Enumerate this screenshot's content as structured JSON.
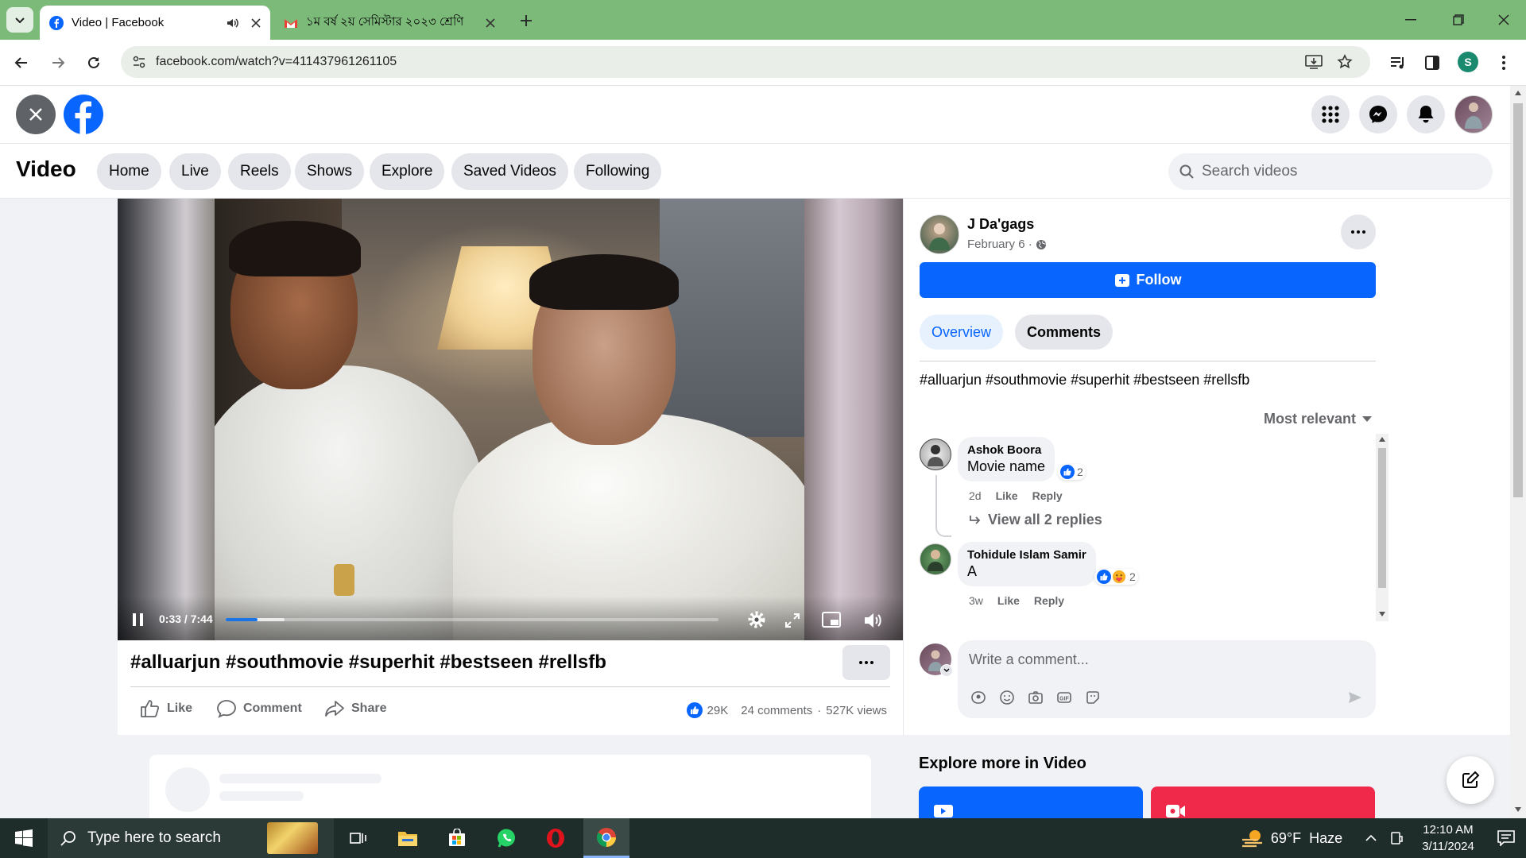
{
  "browser": {
    "tabs": [
      {
        "title": "Video | Facebook",
        "active": true
      },
      {
        "title": "১ম বর্ষ ২য় সেমিস্টার ২০২৩ শ্রেণি",
        "active": false
      }
    ],
    "url": "facebook.com/watch?v=411437961261105",
    "profile_initial": "S"
  },
  "nav": {
    "title": "Video",
    "items": [
      "Home",
      "Live",
      "Reels",
      "Shows",
      "Explore",
      "Saved Videos",
      "Following"
    ],
    "search_placeholder": "Search videos"
  },
  "player": {
    "time": "0:33 / 7:44",
    "progress": 0.065,
    "buffered": 0.12
  },
  "post": {
    "caption": "#alluarjun #southmovie #superhit #bestseen #rellsfb",
    "actions": {
      "like": "Like",
      "comment": "Comment",
      "share": "Share"
    },
    "reaction_count": "29K",
    "comments_count": "24 comments",
    "views": "527K views"
  },
  "author": {
    "name": "J Da'gags",
    "date": "February 6 ·",
    "follow_label": "Follow"
  },
  "panel": {
    "tabs": [
      "Overview",
      "Comments"
    ],
    "description": "#alluarjun #southmovie #superhit #bestseen #rellsfb",
    "sort_label": "Most relevant",
    "comments": [
      {
        "author": "Ashok Boora",
        "text": "Movie name",
        "reactions": "2",
        "age": "2d",
        "like": "Like",
        "reply": "Reply",
        "view_replies": "View all 2 replies"
      },
      {
        "author": "Tohidule Islam Samir",
        "text": "A",
        "reactions": "2",
        "age": "3w",
        "like": "Like",
        "reply": "Reply"
      }
    ],
    "comment_placeholder": "Write a comment...",
    "explore_title": "Explore more in Video"
  },
  "taskbar": {
    "search_placeholder": "Type here to search",
    "weather": "69°F  Haze",
    "time": "12:10 AM",
    "date": "3/11/2024"
  },
  "colors": {
    "fb_blue": "#0866ff",
    "tab_bar": "#7cba7a",
    "taskbar": "#1f2d2a"
  }
}
